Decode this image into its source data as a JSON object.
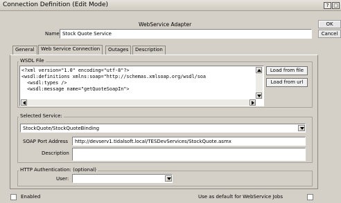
{
  "window": {
    "title": "Connection Definition (Edit Mode)",
    "help_label": "?",
    "restore_label": "□"
  },
  "header": {
    "adapter_label": "WebService Adapter",
    "name_label": "Name",
    "name_value": "Stock Quote Service"
  },
  "side_buttons": {
    "ok_label": "OK",
    "cancel_label": "Cancel"
  },
  "tabs": [
    {
      "label": "General"
    },
    {
      "label": "Web Service Connection"
    },
    {
      "label": "Outages"
    },
    {
      "label": "Description"
    }
  ],
  "wsdl": {
    "legend": "WSDL File",
    "lines": [
      "<?xml version=\"1.0\" encoding=\"utf-8\"?>",
      "<wsdl:definitions xmlns:soap=\"http://schemas.xmlsoap.org/wsdl/soa",
      "  <wsdl:types />",
      "  <wsdl:message name=\"getQuoteSoapIn\">"
    ],
    "load_file_label": "Load from file",
    "load_url_label": "Load from url"
  },
  "service": {
    "legend": "Selected Service:",
    "selected_value": "StockQuote/StockQuoteBinding",
    "soap_port_label": "SOAP Port Address",
    "soap_port_value": "http://devserv1.tidalsoft.local/TESDevServices/StockQuote.asmx",
    "description_label": "Description",
    "description_value": ""
  },
  "http_auth": {
    "legend": "HTTP Authentication: (optional)",
    "user_label": "User:",
    "user_value": ""
  },
  "footer": {
    "enabled_label": "Enabled",
    "enabled_checked": false,
    "default_label": "Use as default for WebService Jobs",
    "default_checked": false
  }
}
